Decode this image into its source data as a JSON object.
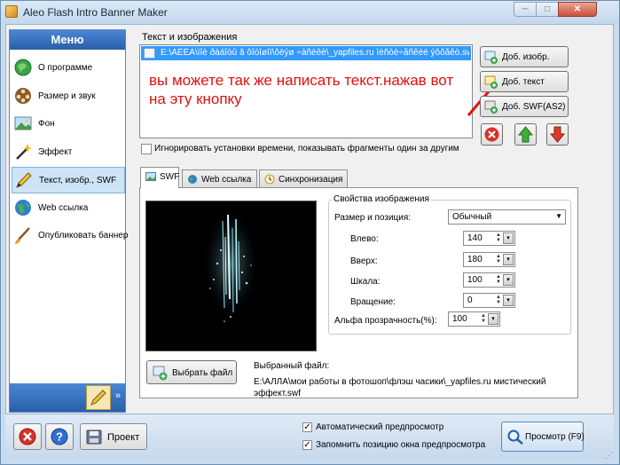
{
  "window": {
    "title": "Aleo Flash Intro Banner Maker",
    "caption_min": "─",
    "caption_max": "□",
    "caption_close": "✕"
  },
  "menu": {
    "header": "Меню",
    "items": [
      {
        "label": "О программе",
        "icon": "info-globe-icon"
      },
      {
        "label": "Размер и звук",
        "icon": "film-reel-icon"
      },
      {
        "label": "Фон",
        "icon": "picture-icon"
      },
      {
        "label": "Эффект",
        "icon": "magic-wand-icon"
      },
      {
        "label": "Текст, изобр., SWF",
        "icon": "pen-icon"
      },
      {
        "label": "Web ссылка",
        "icon": "globe-icon"
      },
      {
        "label": "Опубликовать баннер",
        "icon": "brush-icon"
      }
    ],
    "selected_index": 4,
    "footer_arrow": "»"
  },
  "images_group": {
    "label": "Текст и изображения",
    "list_items": [
      "E:\\ÀËËÀ\\ìîè ðàáîòû â ôîòîøîï\\ôëýø ÷àñèêè\\_yapfiles.ru ìèñòè÷åñêèé ýôôåêò.swf"
    ],
    "annotation": "вы можете так же написать текст.нажав вот на эту кнопку",
    "ignore_timing_label": "Игнорировать установки времени, показывать фрагменты один за другим"
  },
  "side_buttons": {
    "add_image": "Доб. изобр.",
    "add_text": "Доб. текст",
    "add_swf": "Доб. SWF(AS2)"
  },
  "tabs": [
    {
      "label": "SWF",
      "icon": "swf-image-icon"
    },
    {
      "label": "Web ссылка",
      "icon": "globe-icon"
    },
    {
      "label": "Синхронизация",
      "icon": "clock-icon"
    }
  ],
  "props": {
    "group_title": "Свойства изображения",
    "size_position_label": "Размер и позиция:",
    "size_position_value": "Обычный",
    "left_label": "Влево:",
    "left_value": "140",
    "top_label": "Вверх:",
    "top_value": "180",
    "scale_label": "Шкала:",
    "scale_value": "100",
    "rotation_label": "Вращение:",
    "rotation_value": "0",
    "alpha_label": "Альфа прозрачность(%):",
    "alpha_value": "100"
  },
  "file": {
    "choose_button": "Выбрать файл",
    "selected_label": "Выбранный файл:",
    "selected_path": "E:\\АЛЛА\\мои работы в фотошоп\\флэш часики\\_yapfiles.ru мистический эффект.swf"
  },
  "bottom": {
    "project_button": "Проект",
    "auto_preview_label": "Автоматический предпросмотр",
    "auto_preview_checked": true,
    "remember_pos_label": "Запомнить позицию окна предпросмотра",
    "remember_pos_checked": true,
    "preview_button": "Просмотр (F9)"
  },
  "colors": {
    "menu_header": "#2a5ea8",
    "selection": "#3399ff",
    "annotation": "#e01010"
  }
}
